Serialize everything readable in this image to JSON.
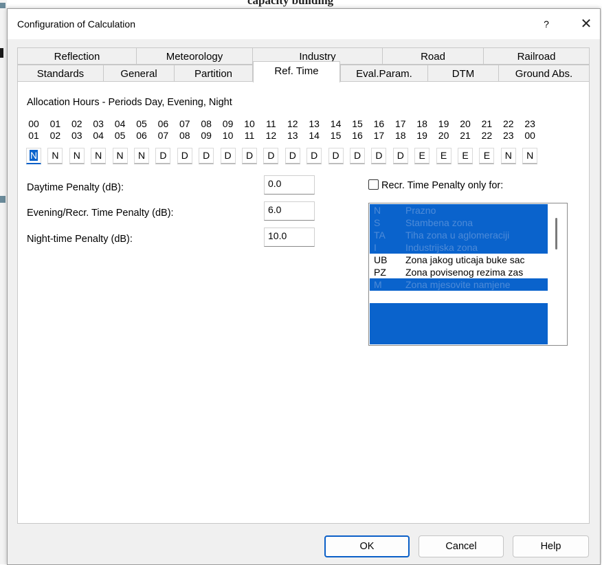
{
  "background": {
    "title_fragment": "capacity building"
  },
  "dialog": {
    "title": "Configuration of Calculation",
    "help_glyph": "?",
    "close_glyph": "✕"
  },
  "tabs_row1": [
    {
      "label": "Reflection"
    },
    {
      "label": "Meteorology"
    },
    {
      "label": "Industry"
    },
    {
      "label": "Road"
    },
    {
      "label": "Railroad"
    }
  ],
  "tabs_row2": [
    {
      "label": "Standards"
    },
    {
      "label": "General"
    },
    {
      "label": "Partition"
    },
    {
      "label": "Ref. Time",
      "active": true
    },
    {
      "label": "Eval.Param."
    },
    {
      "label": "DTM"
    },
    {
      "label": "Ground Abs."
    }
  ],
  "ref_time": {
    "allocation_title": "Allocation Hours - Periods Day, Evening, Night",
    "hours_from": [
      "00",
      "01",
      "02",
      "03",
      "04",
      "05",
      "06",
      "07",
      "08",
      "09",
      "10",
      "11",
      "12",
      "13",
      "14",
      "15",
      "16",
      "17",
      "18",
      "19",
      "20",
      "21",
      "22",
      "23"
    ],
    "hours_to": [
      "01",
      "02",
      "03",
      "04",
      "05",
      "06",
      "07",
      "08",
      "09",
      "10",
      "11",
      "12",
      "13",
      "14",
      "15",
      "16",
      "17",
      "18",
      "19",
      "20",
      "21",
      "22",
      "23",
      "00"
    ],
    "periods": [
      "N",
      "N",
      "N",
      "N",
      "N",
      "N",
      "D",
      "D",
      "D",
      "D",
      "D",
      "D",
      "D",
      "D",
      "D",
      "D",
      "D",
      "D",
      "E",
      "E",
      "E",
      "E",
      "N",
      "N"
    ],
    "daytime_label": "Daytime Penalty (dB):",
    "daytime_value": "0.0",
    "evening_label": "Evening/Recr. Time Penalty (dB):",
    "evening_value": "6.0",
    "night_label": "Night-time Penalty (dB):",
    "night_value": "10.0",
    "recr_checkbox_label": "Recr. Time Penalty only for:",
    "recr_checked": false,
    "zones": [
      {
        "code": "N",
        "desc": "Prazno",
        "selected": true
      },
      {
        "code": "S",
        "desc": "Stambena zona",
        "selected": true
      },
      {
        "code": "TA",
        "desc": "Tiha zona u aglomeraciji",
        "selected": true
      },
      {
        "code": "I",
        "desc": "Industrijska zona",
        "selected": true
      },
      {
        "code": "UB",
        "desc": "Zona jakog uticaja buke sac",
        "selected": false
      },
      {
        "code": "PZ",
        "desc": "Zona povisenog rezima zas",
        "selected": false
      },
      {
        "code": "M",
        "desc": "Zona mjesovite namjene",
        "selected": true
      }
    ]
  },
  "buttons": {
    "ok": "OK",
    "cancel": "Cancel",
    "help": "Help"
  },
  "colors": {
    "selection": "#0a63cc",
    "selection_text": "#4e8bd8",
    "focus": "#0a5fc7"
  }
}
